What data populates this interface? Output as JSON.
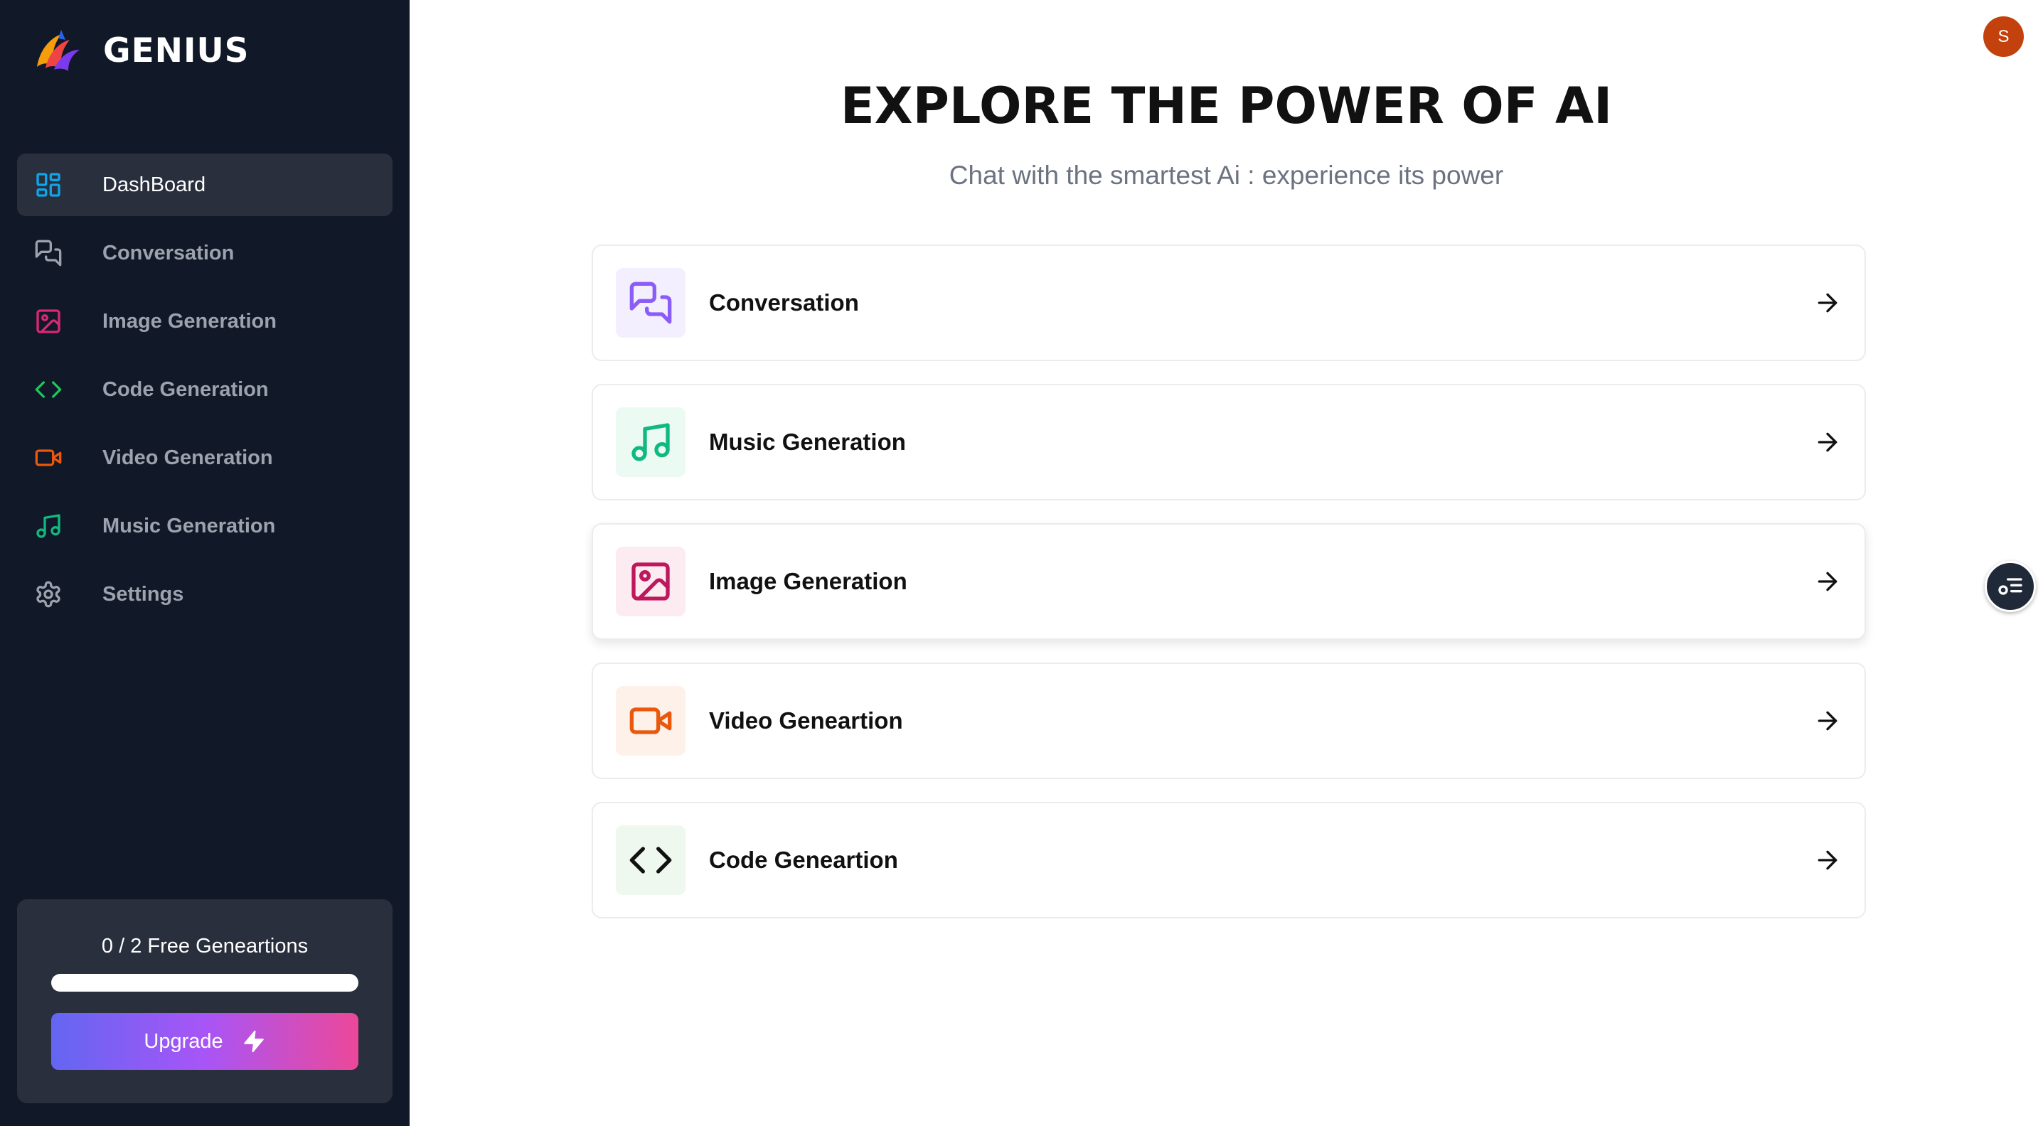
{
  "brand": {
    "name": "GENIUS"
  },
  "sidebar": {
    "items": [
      {
        "label": "DashBoard",
        "icon": "layout-dashboard-icon",
        "color": "#0ea5e9",
        "active": true
      },
      {
        "label": "Conversation",
        "icon": "messages-icon",
        "color": "#9ca3af",
        "active": false
      },
      {
        "label": "Image Generation",
        "icon": "image-icon",
        "color": "#db2777",
        "active": false
      },
      {
        "label": "Code Generation",
        "icon": "code-icon",
        "color": "#22c55e",
        "active": false
      },
      {
        "label": "Video Generation",
        "icon": "video-icon",
        "color": "#ea580c",
        "active": false
      },
      {
        "label": "Music Generation",
        "icon": "music-icon",
        "color": "#10b981",
        "active": false
      },
      {
        "label": "Settings",
        "icon": "settings-icon",
        "color": "#9ca3af",
        "active": false
      }
    ]
  },
  "free_card": {
    "text": "0 / 2 Free Geneartions",
    "progress_fraction": 0,
    "upgrade_label": "Upgrade"
  },
  "header": {
    "avatar_initial": "S"
  },
  "main": {
    "title": "EXPLORE THE POWER OF AI",
    "subtitle": "Chat with the smartest Ai : experience its power",
    "tools": [
      {
        "label": "Conversation",
        "icon": "messages-icon",
        "color": "#8b5cf6",
        "bg": "#f3efff"
      },
      {
        "label": "Music Generation",
        "icon": "music-icon",
        "color": "#10b981",
        "bg": "#ecfaf4"
      },
      {
        "label": "Image Generation",
        "icon": "image-icon",
        "color": "#be185d",
        "bg": "#fcecf2"
      },
      {
        "label": "Video Geneartion",
        "icon": "video-icon",
        "color": "#ea580c",
        "bg": "#fdf1ea"
      },
      {
        "label": "Code Geneartion",
        "icon": "code-icon",
        "color": "#111111",
        "bg": "#eef8ef"
      }
    ]
  }
}
